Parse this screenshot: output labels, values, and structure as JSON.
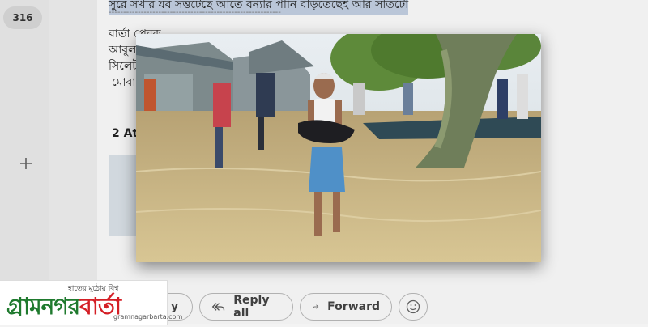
{
  "sidebar": {
    "count_badge": "316"
  },
  "email": {
    "highlighted_line": "সুরে সখার যব সত্তটেছে আতে বন্যার পানি বাড়তেছেই আর সাতটো",
    "separator": "-----------------------------------------------------------",
    "sender_lines": [
      "বার্তা প্রেরক",
      "আবুল",
      "সিলেট",
      "মোবা"
    ],
    "attachments_label": "2 At"
  },
  "actions": {
    "reply_label": "y",
    "reply_all_label": "Reply all",
    "forward_label": "Forward"
  },
  "logo": {
    "tagline": "হাতের মুঠোয় বিশ্ব",
    "name_part1": "গ্রামনগর",
    "name_part2": "বার্তা",
    "url": "gramnagarbarta.com"
  },
  "colors": {
    "logo_green": "#1f7a2e",
    "logo_red": "#d41f26",
    "water": "#c9b27c"
  },
  "icons": [
    "plus-icon",
    "reply-all-icon",
    "forward-icon",
    "emoji-icon"
  ]
}
